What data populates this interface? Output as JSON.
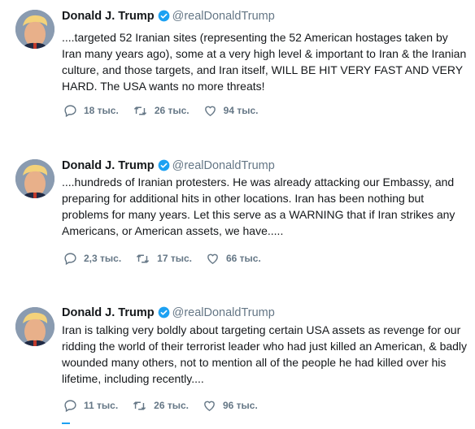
{
  "tweets": [
    {
      "name": "Donald J. Trump",
      "handle": "@realDonaldTrump",
      "text": "....targeted 52 Iranian sites (representing the 52 American hostages taken by Iran many years ago), some at a very high level & important to Iran &  the Iranian culture, and those targets, and Iran itself, WILL BE HIT VERY FAST AND VERY HARD. The USA wants no more threats!",
      "replies": "18 тыс.",
      "retweets": "26 тыс.",
      "likes": "94 тыс."
    },
    {
      "name": "Donald J. Trump",
      "handle": "@realDonaldTrump",
      "text": "....hundreds of Iranian protesters. He was already attacking our Embassy, and preparing for additional hits in other locations. Iran has been nothing but problems for many years. Let this serve as a WARNING that if Iran strikes any Americans, or American assets, we have.....",
      "replies": "2,3 тыс.",
      "retweets": "17 тыс.",
      "likes": "66 тыс."
    },
    {
      "name": "Donald J. Trump",
      "handle": "@realDonaldTrump",
      "text": "Iran is talking very boldly about targeting certain USA assets as revenge for our ridding the world of their terrorist leader who had just killed an American, & badly wounded many others, not to mention all of the people he had killed over his lifetime, including recently....",
      "replies": "11 тыс.",
      "retweets": "26 тыс.",
      "likes": "96 тыс."
    }
  ],
  "icons": {
    "reply": "reply-icon",
    "retweet": "retweet-icon",
    "like": "heart-icon",
    "verified": "verified-badge-icon"
  },
  "colors": {
    "text": "#14171a",
    "secondary": "#657786",
    "verified": "#1da1f2",
    "background": "#ffffff"
  }
}
